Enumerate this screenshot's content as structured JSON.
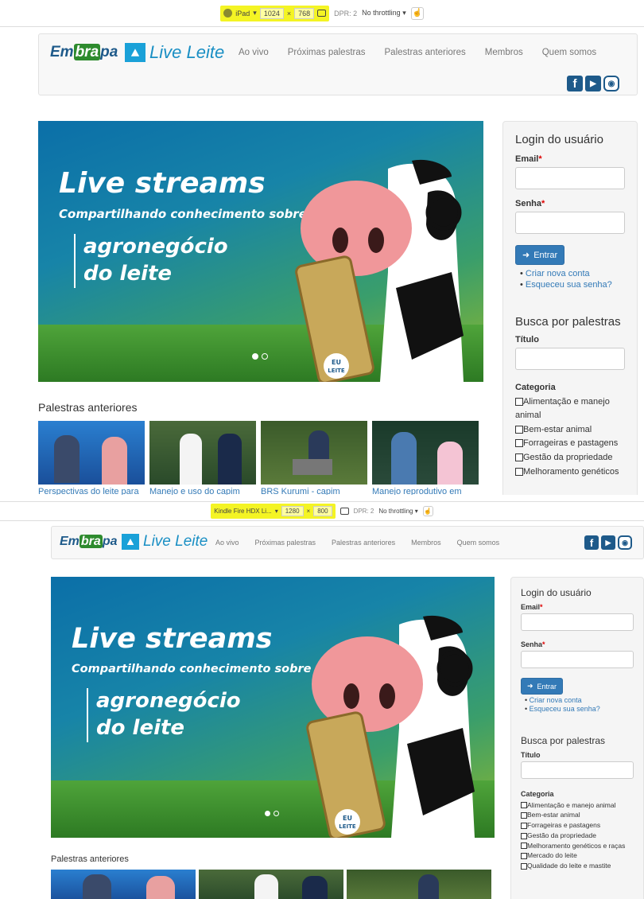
{
  "devtools_top": {
    "device": "iPad",
    "width": "1024",
    "height": "768",
    "dpr": "DPR: 2",
    "throttling": "No throttling"
  },
  "devtools_bottom": {
    "device": "Kindle Fire HDX Li...",
    "width": "1280",
    "height": "800",
    "dpr": "DPR: 2",
    "throttling": "No throttling"
  },
  "brand": {
    "embrapa_pre": "Em",
    "embrapa_mid": "bra",
    "embrapa_post": "pa",
    "live": "Live Leite"
  },
  "nav": [
    "Ao vivo",
    "Próximas palestras",
    "Palestras anteriores",
    "Membros",
    "Quem somos"
  ],
  "banner": {
    "title": "Live streams",
    "subtitle": "Compartilhando conhecimento sobre o",
    "line1": "agronegócio",
    "line2": "do leite",
    "badge_line1": "EU",
    "badge_line2": "LEITE"
  },
  "login": {
    "title": "Login do usuário",
    "email_label": "Email",
    "password_label": "Senha",
    "required_mark": "*",
    "submit": "Entrar",
    "links": [
      "Criar nova conta",
      "Esqueceu sua senha?"
    ]
  },
  "search": {
    "title": "Busca por palestras",
    "title_label": "Título",
    "category_label": "Categoria",
    "categories_top": [
      "Alimentação e manejo animal",
      "Bem-estar animal",
      "Forrageiras e pastagens",
      "Gestão da propriedade",
      "Melhoramento genéticos"
    ],
    "categories_bottom": [
      "Alimentação e manejo animal",
      "Bem-estar animal",
      "Forrageiras e pastagens",
      "Gestão da propriedade",
      "Melhoramento genéticos e raças",
      "Mercado do leite",
      "Qualidade do leite e mastite"
    ]
  },
  "previous": {
    "title": "Palestras anteriores",
    "items": [
      "Perspectivas do leite para",
      "Manejo e uso do capim",
      "BRS Kurumi - capim",
      "Manejo reprodutivo em"
    ]
  },
  "colors": {
    "primary": "#337ab7",
    "brand_blue": "#1e5a8a",
    "highlight": "#f4f424"
  }
}
